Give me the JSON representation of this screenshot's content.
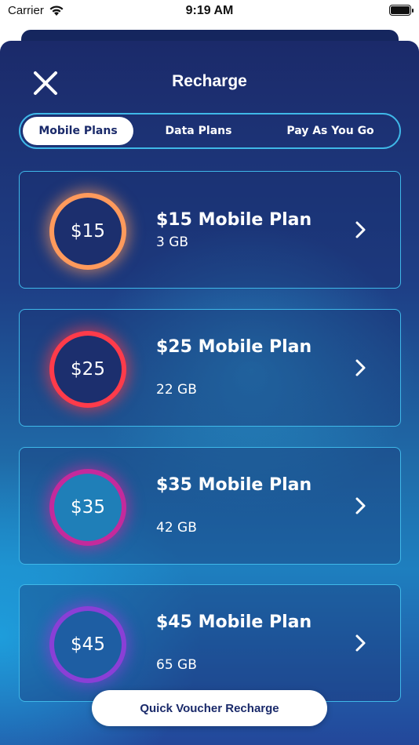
{
  "status_bar": {
    "carrier": "Carrier",
    "time": "9:19 AM"
  },
  "header": {
    "title": "Recharge"
  },
  "tabs": [
    {
      "label": "Mobile Plans",
      "active": true
    },
    {
      "label": "Data Plans",
      "active": false
    },
    {
      "label": "Pay As You Go",
      "active": false
    }
  ],
  "plans": [
    {
      "price": "$15",
      "name": "$15 Mobile Plan",
      "data": "3 GB",
      "ring_color": "#ff9a5c"
    },
    {
      "price": "$25",
      "name": "$25 Mobile Plan",
      "data": "22 GB",
      "ring_color": "#ff3b4a"
    },
    {
      "price": "$35",
      "name": "$35 Mobile Plan",
      "data": "42 GB",
      "ring_color": "#c42a9c"
    },
    {
      "price": "$45",
      "name": "$45 Mobile Plan",
      "data": "65 GB",
      "ring_color": "#8a3fd6"
    }
  ],
  "quick_voucher": {
    "label": "Quick Voucher Recharge"
  },
  "colors": {
    "accent": "#3fb8e8",
    "navy": "#1a2a6a"
  }
}
